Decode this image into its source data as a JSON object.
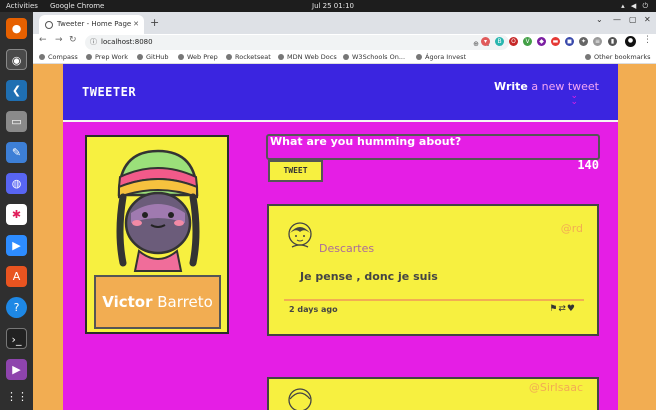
{
  "os": {
    "activities": "Activities",
    "app_name": "Google Chrome",
    "clock": "Jul 25  01:10"
  },
  "browser": {
    "tab_title": "Tweeter - Home Page",
    "url": "localhost:8080",
    "bookmarks": [
      "Compass",
      "Prep Work",
      "GitHub",
      "Web Prep",
      "Rocketseat",
      "MDN Web Docs",
      "W3Schools On...",
      "Ágora Invest"
    ],
    "other_bookmarks": "Other bookmarks"
  },
  "header": {
    "brand": "TWEETER",
    "write_strong": "Write",
    "write_rest": " a new tweet"
  },
  "profile": {
    "first_name": "Victor",
    "last_name": "Barreto"
  },
  "composer": {
    "placeholder": "What are you humming about?",
    "button_label": "TWEET",
    "counter": "140"
  },
  "tweets": [
    {
      "name": "Descartes",
      "handle": "@rd",
      "content": "Je pense , donc je suis",
      "date": "2 days ago"
    },
    {
      "handle": "@SirIsaac"
    }
  ],
  "colors": {
    "page_bg": "#f2ad52",
    "main_bg": "#e51ee5",
    "nav_bg": "#3b25e0",
    "card_bg": "#f7f040"
  }
}
